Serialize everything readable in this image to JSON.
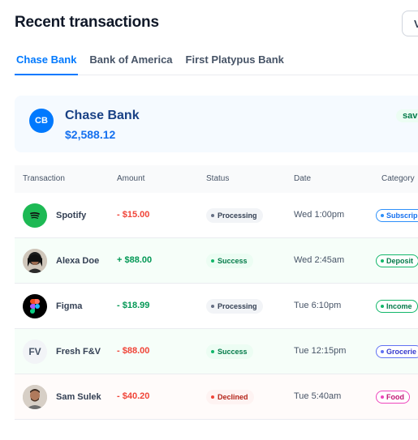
{
  "header": {
    "title": "Recent transactions",
    "view_all_label": "V"
  },
  "tabs": [
    {
      "label": "Chase Bank",
      "active": true
    },
    {
      "label": "Bank of America",
      "active": false
    },
    {
      "label": "First Platypus Bank",
      "active": false
    }
  ],
  "bank_card": {
    "initials": "CB",
    "name": "Chase Bank",
    "balance": "$2,588.12",
    "type_badge": "savi"
  },
  "table": {
    "columns": [
      "Transaction",
      "Amount",
      "Status",
      "Date",
      "Category"
    ],
    "rows": [
      {
        "merchant": "Spotify",
        "amount": "- $15.00",
        "status": "Processing",
        "date": "Wed 1:00pm",
        "category": "Subscrip"
      },
      {
        "merchant": "Alexa Doe",
        "amount": "+ $88.00",
        "status": "Success",
        "date": "Wed 2:45am",
        "category": "Deposit"
      },
      {
        "merchant": "Figma",
        "amount": "- $18.99",
        "status": "Processing",
        "date": "Tue 6:10pm",
        "category": "Income"
      },
      {
        "merchant": "Fresh F&V",
        "initials": "FV",
        "amount": "- $88.00",
        "status": "Success",
        "date": "Tue 12:15pm",
        "category": "Grocerie"
      },
      {
        "merchant": "Sam Sulek",
        "amount": "- $40.20",
        "status": "Declined",
        "date": "Tue 5:40am",
        "category": "Food"
      }
    ]
  },
  "colors": {
    "accent": "#0179fe",
    "positive": "#039855",
    "negative": "#f04438"
  }
}
